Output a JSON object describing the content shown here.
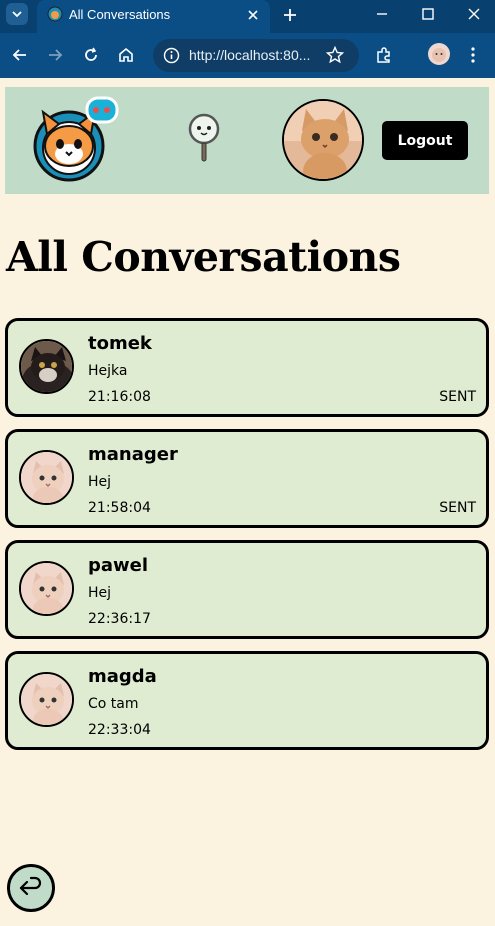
{
  "browser": {
    "tab_title": "All Conversations",
    "url": "http://localhost:80..."
  },
  "header": {
    "logout_label": "Logout"
  },
  "page": {
    "title": "All Conversations"
  },
  "conversations": [
    {
      "name": "tomek",
      "message": "Hejka",
      "time": "21:16:08",
      "status": "SENT",
      "avatar": "dark-cat"
    },
    {
      "name": "manager",
      "message": "Hej",
      "time": "21:58:04",
      "status": "SENT",
      "avatar": "beige-cat"
    },
    {
      "name": "pawel",
      "message": "Hej",
      "time": "22:36:17",
      "status": "",
      "avatar": "beige-cat"
    },
    {
      "name": "magda",
      "message": "Co tam",
      "time": "22:33:04",
      "status": "",
      "avatar": "beige-cat"
    }
  ],
  "colors": {
    "background": "#fbf3df",
    "header_bg": "#c0dcc8",
    "card_bg": "#e0ecd2",
    "browser_chrome": "#0b4e86"
  },
  "icons": [
    "tab-search-icon",
    "favicon-icon",
    "close-icon",
    "new-tab-icon",
    "minimize-icon",
    "maximize-icon",
    "window-close-icon",
    "back-icon",
    "forward-icon",
    "reload-icon",
    "home-icon",
    "site-info-icon",
    "star-icon",
    "extensions-icon",
    "profile-icon",
    "menu-icon",
    "logo-icon",
    "search-icon",
    "return-icon"
  ]
}
